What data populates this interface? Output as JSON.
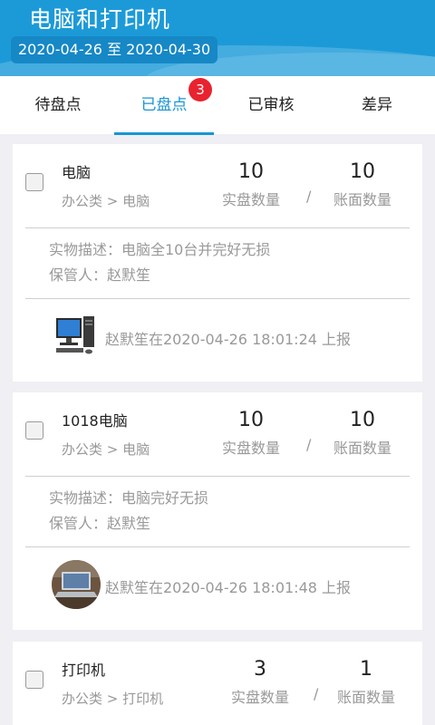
{
  "header": {
    "title": "电脑和打印机",
    "date_range": "2020-04-26 至 2020-04-30"
  },
  "tabs": [
    {
      "label": "待盘点"
    },
    {
      "label": "已盘点",
      "active": true,
      "badge": "3"
    },
    {
      "label": "已审核"
    },
    {
      "label": "差异"
    }
  ],
  "labels": {
    "actual_qty": "实盘数量",
    "book_qty": "账面数量",
    "slash": "/"
  },
  "items": [
    {
      "name": "电脑",
      "category": "办公类 > 电脑",
      "actual": "10",
      "book": "10",
      "description": "实物描述：电脑全10台并完好无损",
      "keeper": "保管人：赵默笙",
      "report": "赵默笙在2020-04-26 18:01:24 上报",
      "thumb_icon": "desktop-computer-icon"
    },
    {
      "name": "1018电脑",
      "category": "办公类 > 电脑",
      "actual": "10",
      "book": "10",
      "description": "实物描述：电脑完好无损",
      "keeper": "保管人：赵默笙",
      "report": "赵默笙在2020-04-26 18:01:48 上报",
      "thumb_icon": "laptop-photo-icon"
    },
    {
      "name": "打印机",
      "category": "办公类 > 打印机",
      "actual": "3",
      "book": "1"
    }
  ],
  "colors": {
    "header": "#1c9ad8",
    "accent": "#1a95d3",
    "badge": "#e8232f"
  }
}
